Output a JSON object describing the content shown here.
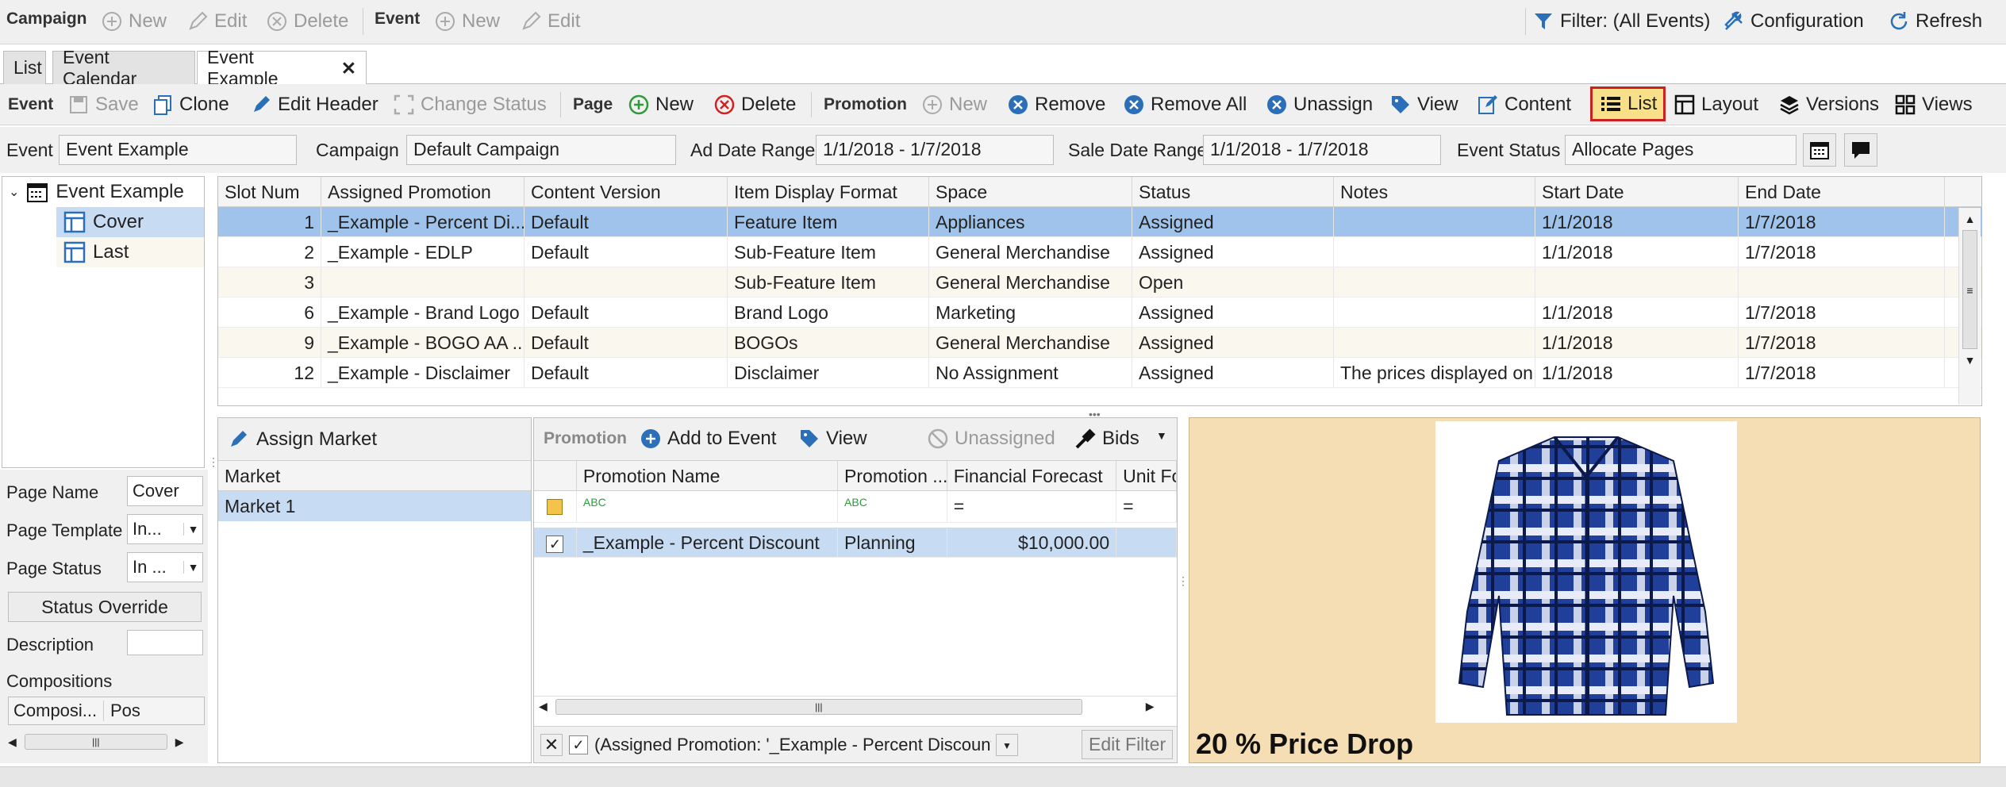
{
  "campaign_bar": {
    "campaign_label": "Campaign",
    "new": "New",
    "edit": "Edit",
    "delete": "Delete",
    "event_label": "Event",
    "event_new": "New",
    "event_edit": "Edit",
    "filter": "Filter: (All Events)",
    "configuration": "Configuration",
    "refresh": "Refresh"
  },
  "tabs": [
    {
      "label": "List"
    },
    {
      "label": "Event Calendar"
    },
    {
      "label": "Event Example"
    }
  ],
  "action_bar": {
    "event_label": "Event",
    "save": "Save",
    "clone": "Clone",
    "edit_header": "Edit Header",
    "change_status": "Change Status",
    "page_label": "Page",
    "page_new": "New",
    "page_delete": "Delete",
    "promotion_label": "Promotion",
    "promo_new": "New",
    "remove": "Remove",
    "remove_all": "Remove All",
    "unassign": "Unassign",
    "view": "View",
    "content": "Content",
    "list": "List",
    "layout": "Layout",
    "versions": "Versions",
    "views": "Views"
  },
  "header": {
    "event_label": "Event",
    "event_value": "Event Example",
    "campaign_label": "Campaign",
    "campaign_value": "Default Campaign",
    "ad_date_label": "Ad Date Range",
    "ad_date_value": "1/1/2018 - 1/7/2018",
    "sale_date_label": "Sale Date Range",
    "sale_date_value": "1/1/2018 - 1/7/2018",
    "status_label": "Event Status",
    "status_value": "Allocate Pages"
  },
  "tree": {
    "root": "Event Example",
    "children": [
      {
        "label": "Cover"
      },
      {
        "label": "Last"
      }
    ]
  },
  "page_props": {
    "name_label": "Page Name",
    "name_value": "Cover",
    "template_label": "Page Template",
    "template_value": "In...",
    "status_label": "Page Status",
    "status_value": "In ...",
    "override_btn": "Status Override",
    "description_label": "Description",
    "compositions_label": "Compositions",
    "comp_col1": "Composi...",
    "comp_col2": "Pos"
  },
  "slots": {
    "columns": [
      "Slot Num",
      "Assigned Promotion",
      "Content Version",
      "Item Display Format",
      "Space",
      "Status",
      "Notes",
      "Start Date",
      "End Date"
    ],
    "rows": [
      [
        "1",
        "_Example - Percent Di...",
        "Default",
        "Feature Item",
        "Appliances",
        "Assigned",
        "",
        "1/1/2018",
        "1/7/2018"
      ],
      [
        "2",
        "_Example - EDLP",
        "Default",
        "Sub-Feature Item",
        "General Merchandise",
        "Assigned",
        "",
        "1/1/2018",
        "1/7/2018"
      ],
      [
        "3",
        "",
        "",
        "Sub-Feature Item",
        "General Merchandise",
        "Open",
        "",
        "",
        ""
      ],
      [
        "6",
        "_Example - Brand Logo",
        "Default",
        "Brand Logo",
        "Marketing",
        "Assigned",
        "",
        "1/1/2018",
        "1/7/2018"
      ],
      [
        "9",
        "_Example - BOGO AA ...",
        "Default",
        "BOGOs",
        "General Merchandise",
        "Assigned",
        "",
        "1/1/2018",
        "1/7/2018"
      ],
      [
        "12",
        "_Example - Disclaimer",
        "Default",
        "Disclaimer",
        "No Assignment",
        "Assigned",
        "The prices displayed on",
        "1/1/2018",
        "1/7/2018"
      ]
    ]
  },
  "market": {
    "assign_btn": "Assign Market",
    "column": "Market",
    "rows": [
      "Market 1"
    ]
  },
  "promotion_panel": {
    "label": "Promotion",
    "add_to_event": "Add to Event",
    "view": "View",
    "unassigned": "Unassigned",
    "bids": "Bids",
    "columns": [
      "Promotion Name",
      "Promotion ...",
      "Financial Forecast",
      "Unit Fo"
    ],
    "filter_eq": "=",
    "rows": [
      [
        "_Example - Percent Discount",
        "Planning",
        "$10,000.00",
        ""
      ]
    ],
    "filter_text": "(Assigned Promotion: '_Example - Percent Discount')",
    "edit_filter": "Edit Filter"
  },
  "preview": {
    "caption": "20 % Price Drop",
    "image_alt": "plaid-shirt"
  },
  "colors": {
    "toolbar_bg": "#f0f0f0",
    "selected_row": "#9fc3ea",
    "preview_bg": "#f5deb3",
    "highlight_border": "#cc1f1f"
  }
}
